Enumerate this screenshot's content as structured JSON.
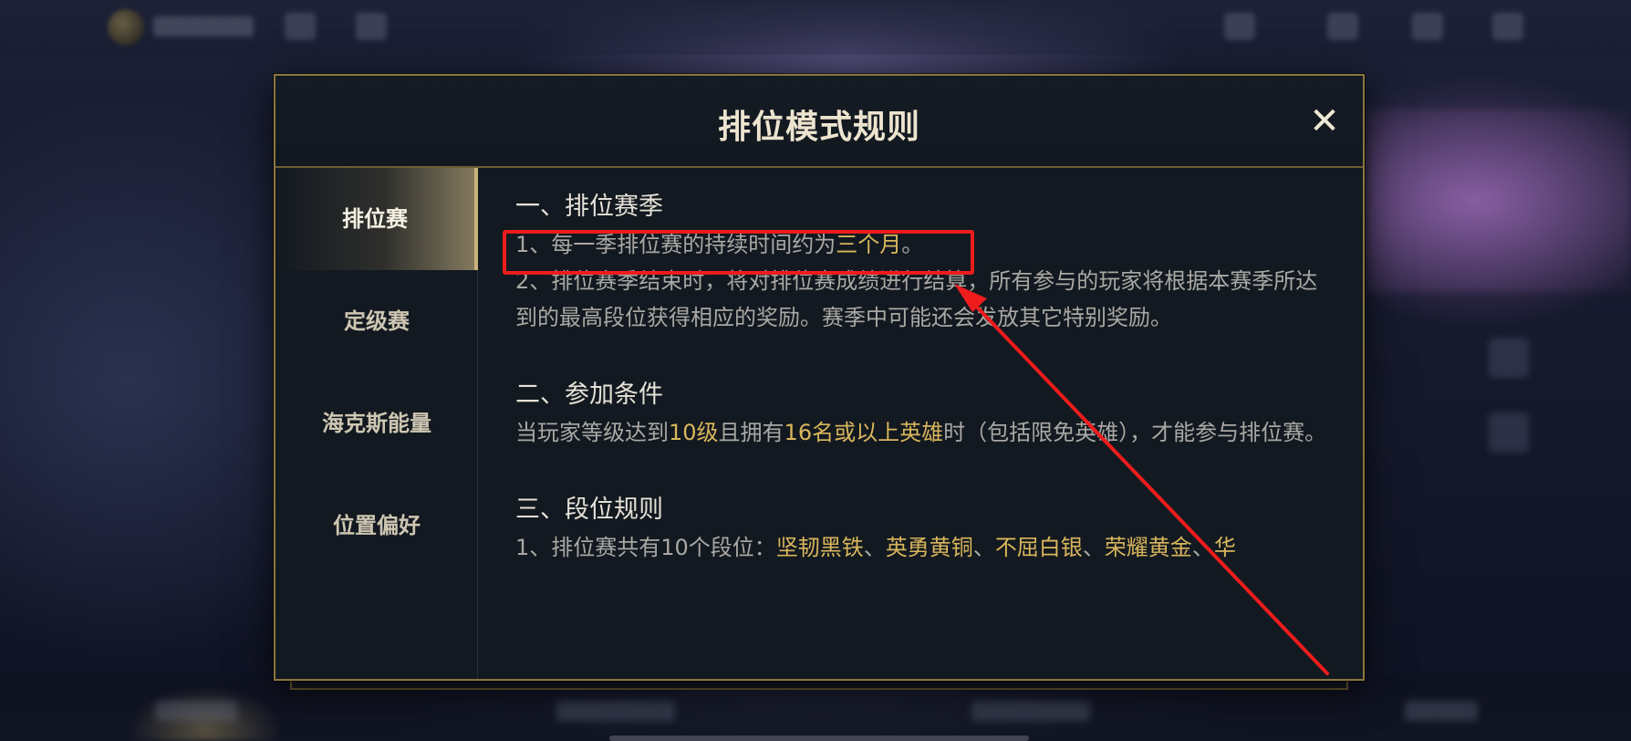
{
  "dialog": {
    "title": "排位模式规则",
    "close_symbol": "✕"
  },
  "tabs": [
    {
      "label": "排位赛",
      "active": true
    },
    {
      "label": "定级赛",
      "active": false
    },
    {
      "label": "海克斯能量",
      "active": false
    },
    {
      "label": "位置偏好",
      "active": false
    }
  ],
  "sections": {
    "season": {
      "heading": "一、排位赛季",
      "item1_text": "1、每一季排位赛的持续时间约为",
      "item1_highlight": "三个月",
      "item1_end": "。",
      "item2_text": "2、排位赛季结束时，将对排位赛成绩进行结算，所有参与的玩家将根据本赛季所达到的最高段位获得相应的奖励。赛季中可能还会发放其它特别奖励。"
    },
    "conditions": {
      "heading": "二、参加条件",
      "text_a": "当玩家等级达到",
      "hl_level": "10级",
      "text_b": "且拥有",
      "hl_heroes": "16名或以上英雄",
      "text_c": "时（包括限免英雄），才能参与排位赛。"
    },
    "tiers": {
      "heading": "三、段位规则",
      "text_a": "1、排位赛共有10个段位：",
      "tier1": "坚韧黑铁",
      "sep": "、",
      "tier2": "英勇黄铜",
      "tier3": "不屈白银",
      "tier4": "荣耀黄金",
      "tier5_partial": "华"
    }
  },
  "annotation": {
    "color": "#ee1c1c"
  },
  "colors": {
    "gold_border": "#8a7640",
    "highlight": "#d9b65c",
    "body_text": "#a9a8a4",
    "heading_text": "#e6e2d8"
  }
}
